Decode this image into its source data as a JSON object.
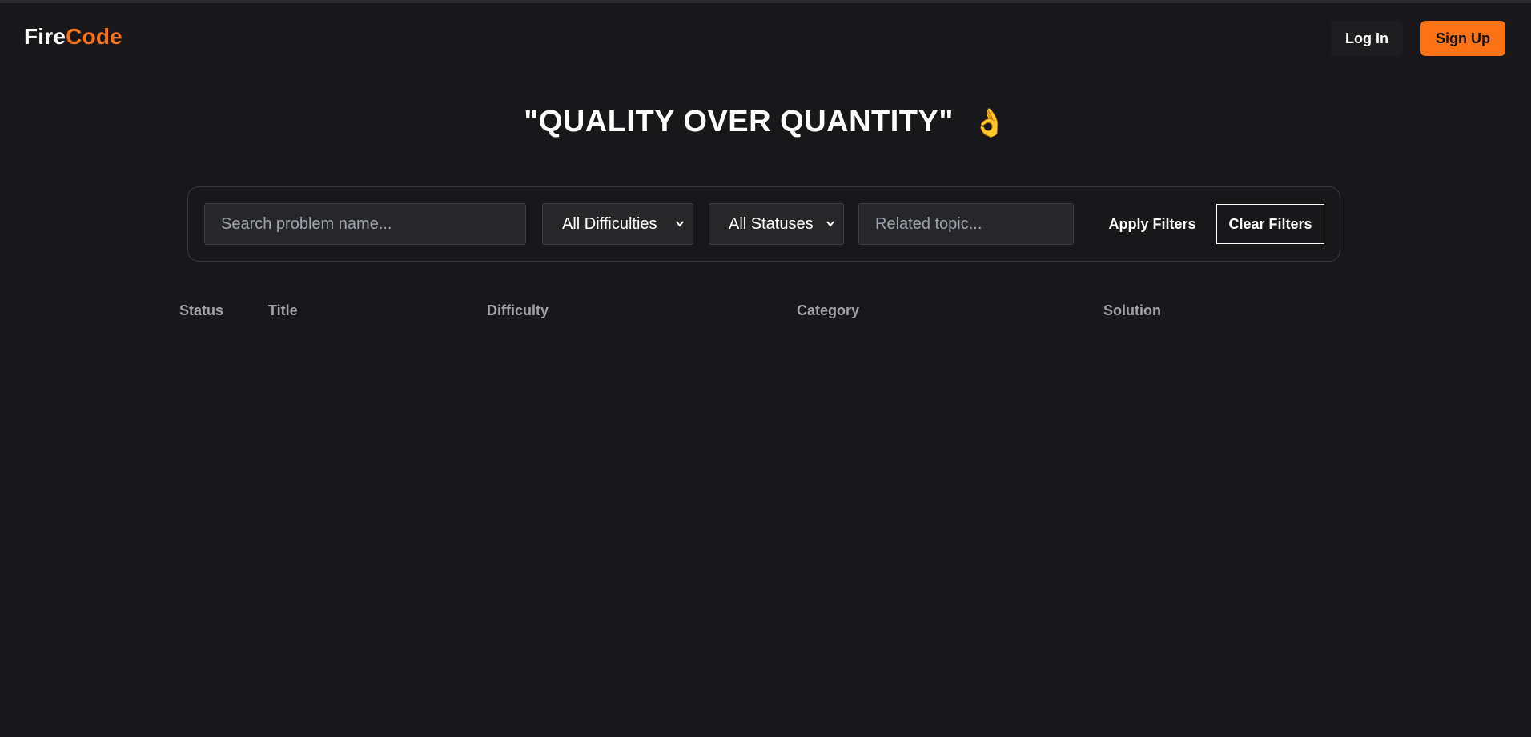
{
  "header": {
    "logo_part1": "Fire",
    "logo_part2": "Code",
    "login_label": "Log In",
    "signup_label": "Sign Up"
  },
  "hero": {
    "quote": "\"QUALITY OVER QUANTITY\"",
    "emoji": "👌"
  },
  "filters": {
    "search_placeholder": "Search problem name...",
    "search_value": "",
    "difficulty_selected": "All Difficulties",
    "status_selected": "All Statuses",
    "topic_placeholder": "Related topic...",
    "topic_value": "",
    "apply_label": "Apply Filters",
    "clear_label": "Clear Filters"
  },
  "table": {
    "columns": [
      "Status",
      "Title",
      "Difficulty",
      "Category",
      "Solution"
    ],
    "rows": []
  },
  "colors": {
    "background": "#18181b",
    "accent": "#f97316",
    "field_bg": "#27272a",
    "header_text": "#a1a1aa"
  },
  "icons": {
    "select_chevron": "chevron-down-icon"
  }
}
